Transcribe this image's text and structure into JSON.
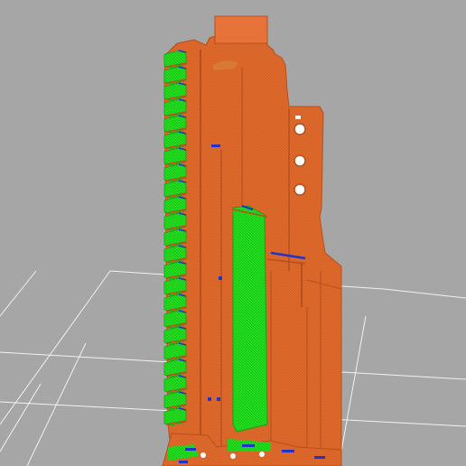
{
  "viewport": {
    "colors": {
      "background": "#a6a6a6",
      "grid_lines": "#f2f2f2",
      "perimeter": "#e06a2c",
      "perimeter_dark": "#b84f1c",
      "infill": "#22e01f",
      "infill_dark": "#15a313",
      "support_edge": "#2233cc"
    }
  }
}
